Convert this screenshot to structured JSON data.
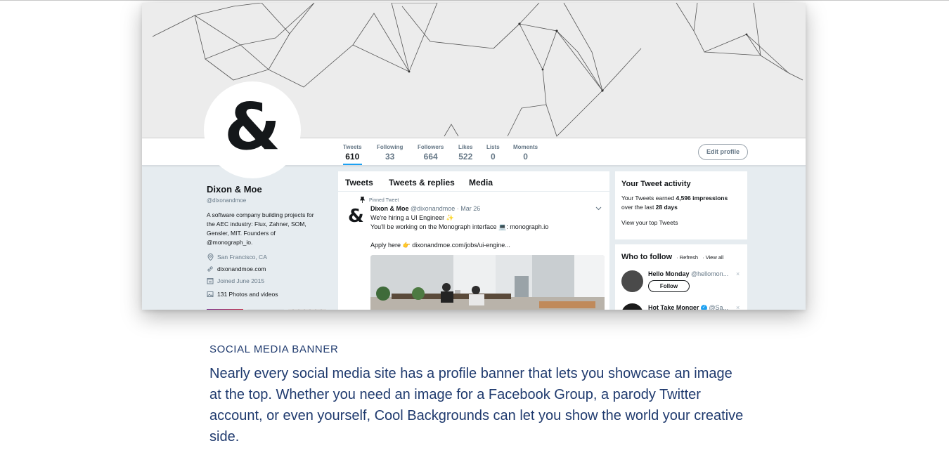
{
  "profile_stats": [
    {
      "label": "Tweets",
      "value": "610"
    },
    {
      "label": "Following",
      "value": "33"
    },
    {
      "label": "Followers",
      "value": "664"
    },
    {
      "label": "Likes",
      "value": "522"
    },
    {
      "label": "Lists",
      "value": "0"
    },
    {
      "label": "Moments",
      "value": "0"
    }
  ],
  "edit_profile_label": "Edit profile",
  "avatar_glyph": "&",
  "profile": {
    "name": "Dixon & Moe",
    "handle": "@dixonandmoe",
    "bio_lines": [
      "A software company building projects for",
      "the AEC industry: Flux, Zahner, SOM,",
      "Gensler, MIT. Founders of",
      "@monograph_io."
    ],
    "location": "San Francisco, CA",
    "website": "dixonandmoe.com",
    "joined": "Joined June 2015",
    "photos": "131 Photos and videos"
  },
  "feed": {
    "tabs": [
      "Tweets",
      "Tweets & replies",
      "Media"
    ],
    "pinned_label": "Pinned Tweet",
    "tweet": {
      "name": "Dixon & Moe",
      "handle": "@dixonandmoe",
      "date": "· Mar 26",
      "line1": "We're hiring a UI Engineer ✨",
      "line2": "You'll be working on the Monograph interface 💻: monograph.io",
      "line3": "Apply here 👉 dixonandmoe.com/jobs/ui-engine..."
    }
  },
  "activity": {
    "title": "Your Tweet activity",
    "text_pre": "Your Tweets earned ",
    "impressions": "4,596 impressions",
    "text_mid": "over the last ",
    "days": "28 days",
    "link": "View your top Tweets"
  },
  "who_to_follow": {
    "title": "Who to follow",
    "refresh": "· Refresh",
    "view_all": "· View all",
    "accounts": [
      {
        "name": "Hello Monday",
        "handle": "@hellomon...",
        "button": "Follow"
      },
      {
        "name": "Hot Take Monger",
        "handle": "@Sa..."
      }
    ],
    "dismiss": "×"
  },
  "caption": {
    "title": "SOCIAL MEDIA BANNER",
    "body": "Nearly every social media site has a profile banner that lets you showcase an image at the top. Whether you need an image for a Facebook Group, a parody Twitter account, or even yourself, Cool Backgrounds can let you show the world your creative side."
  },
  "colors": {
    "caption_text": "#1f3a6e",
    "twitter_blue": "#1da1f2",
    "page_bg": "#e6ecf0"
  }
}
